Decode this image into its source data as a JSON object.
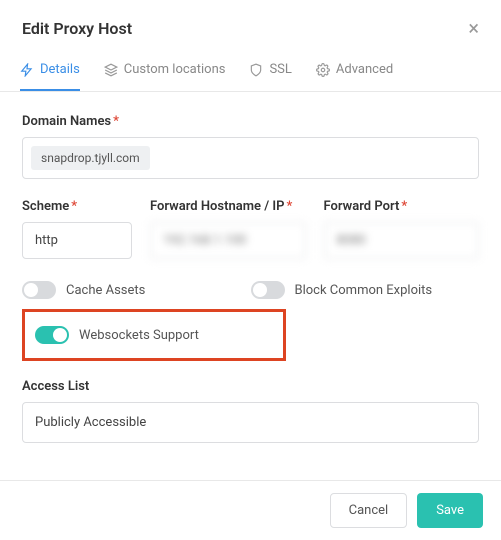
{
  "header": {
    "title": "Edit Proxy Host"
  },
  "tabs": {
    "details": "Details",
    "custom_locations": "Custom locations",
    "ssl": "SSL",
    "advanced": "Advanced"
  },
  "domain": {
    "label": "Domain Names",
    "value": "snapdrop.tjyll.com"
  },
  "scheme": {
    "label": "Scheme",
    "value": "http"
  },
  "hostname": {
    "label": "Forward Hostname / IP",
    "value": "192.168.1.100"
  },
  "port": {
    "label": "Forward Port",
    "value": "8080"
  },
  "switches": {
    "cache": "Cache Assets",
    "block": "Block Common Exploits",
    "websockets": "Websockets Support"
  },
  "access": {
    "label": "Access List",
    "value": "Publicly Accessible"
  },
  "buttons": {
    "cancel": "Cancel",
    "save": "Save"
  }
}
